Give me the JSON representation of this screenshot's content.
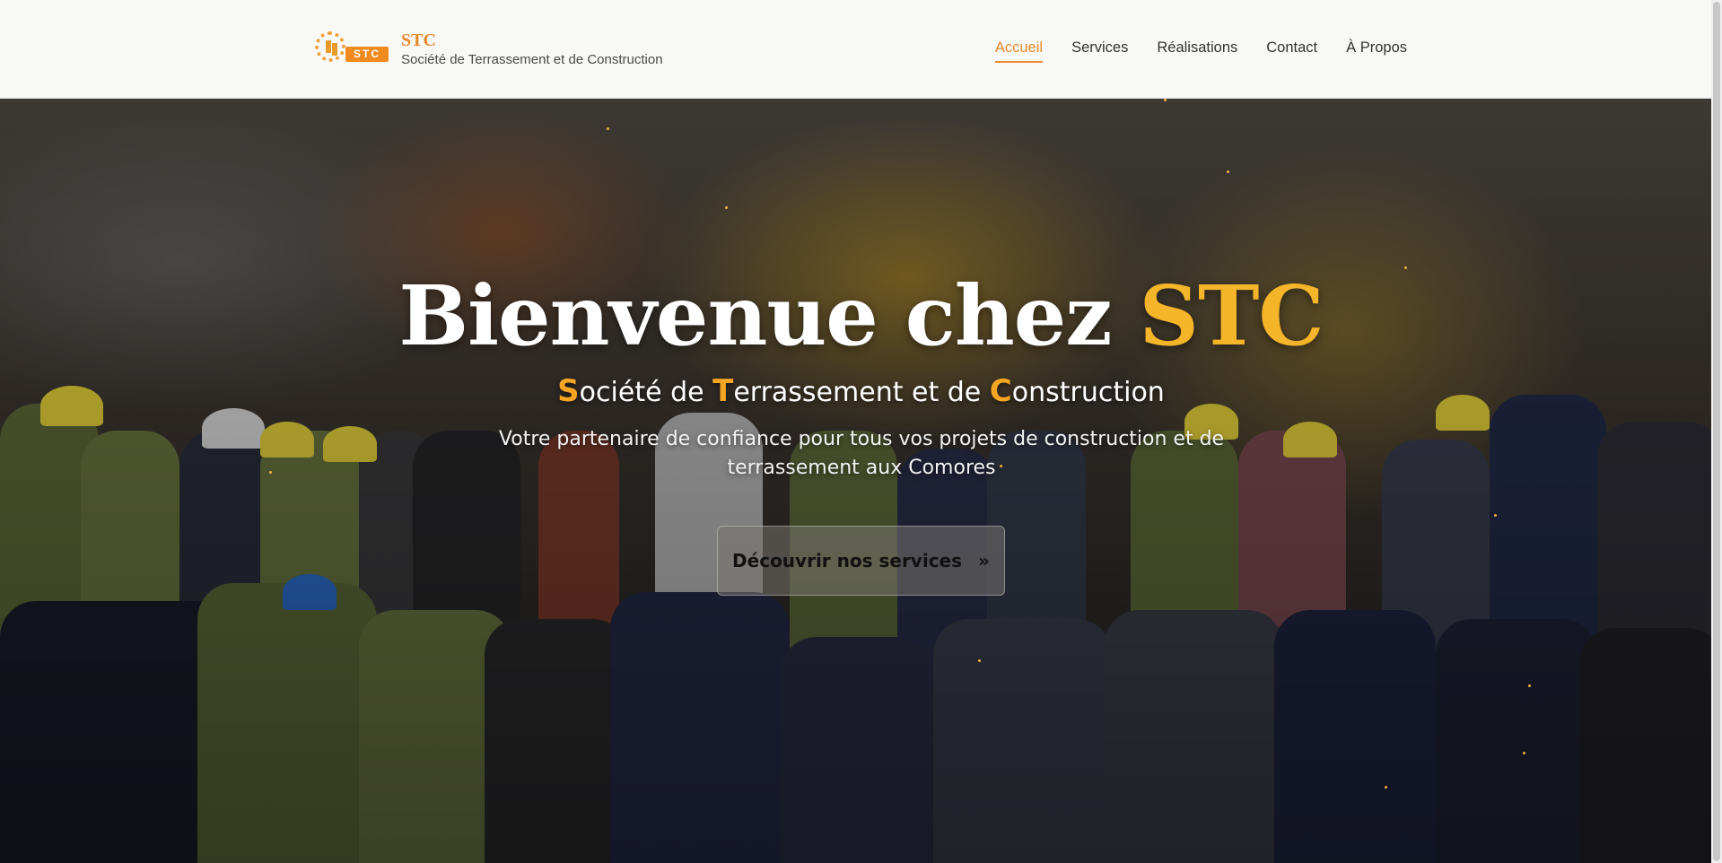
{
  "brand": {
    "logo_text": "STC",
    "name": "STC",
    "tagline": "Société de Terrassement et de Construction"
  },
  "nav": {
    "items": [
      {
        "label": "Accueil",
        "active": true
      },
      {
        "label": "Services",
        "active": false
      },
      {
        "label": "Réalisations",
        "active": false
      },
      {
        "label": "Contact",
        "active": false
      },
      {
        "label": "À Propos",
        "active": false
      }
    ]
  },
  "hero": {
    "title_prefix": "Bienvenue chez ",
    "title_accent": "STC",
    "subtitle_parts": [
      {
        "cap": "S",
        "rest": "ociété de "
      },
      {
        "cap": "T",
        "rest": "errassement et de "
      },
      {
        "cap": "C",
        "rest": "onstruction"
      }
    ],
    "description": "Votre partenaire de confiance pour tous vos projets de construction et de terrassement aux Comores",
    "cta_label": "Découvrir nos services",
    "cta_icon": "double-chevron-right-icon"
  },
  "colors": {
    "accent": "#e8892a",
    "hero_accent": "#f5b52a",
    "header_bg": "#f8f8f7"
  }
}
